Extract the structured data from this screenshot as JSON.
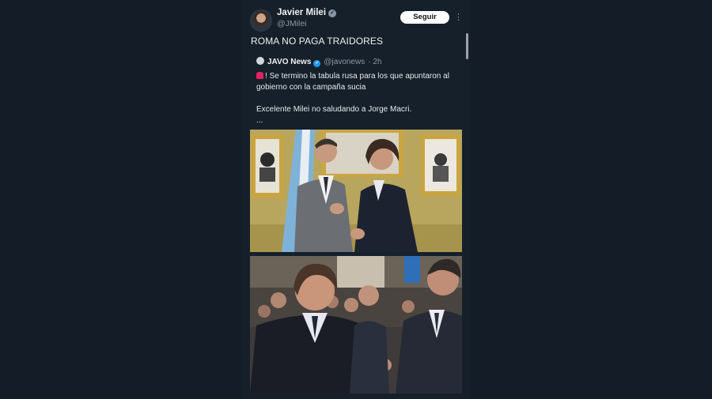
{
  "tweet": {
    "author_name": "Javier Milei",
    "author_handle": "@JMilei",
    "follow_label": "Seguir",
    "more_label": "⋮",
    "text": "ROMA NO PAGA TRAIDORES"
  },
  "quote": {
    "author_name": "JAVO News",
    "author_handle": "@javonews",
    "time": "· 2h",
    "line1": "Se termino la tabula rusa para los que apuntaron al gobierno con la campaña sucia",
    "line2": "Excelente Milei no saludando a Jorge Macri.",
    "line3": "..."
  },
  "icons": {
    "verified": "verified-badge-icon",
    "siren": "siren-emoji-icon"
  },
  "colors": {
    "background": "#141c28",
    "panel": "#15202b",
    "verified_blue": "#1d9bf0"
  }
}
